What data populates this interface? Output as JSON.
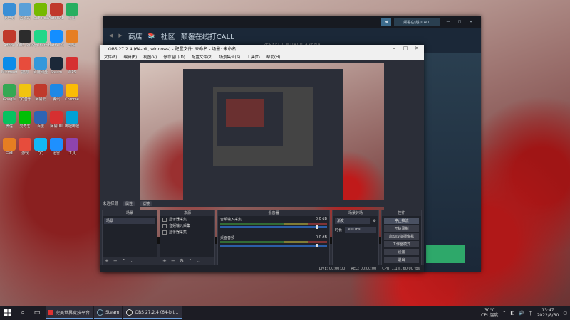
{
  "desktop": {
    "icons": [
      {
        "label": "此电脑",
        "color": "#3a8fd6"
      },
      {
        "label": "回收站",
        "color": "#5aa0d8"
      },
      {
        "label": "GeForce",
        "color": "#76b900"
      },
      {
        "label": "AutoCAD 2014",
        "color": "#c0392b"
      },
      {
        "label": "绘图",
        "color": "#27ae60"
      },
      {
        "label": "Adobe",
        "color": "#c0392b"
      },
      {
        "label": "OBS Studio",
        "color": "#2c2c2c"
      },
      {
        "label": "PyCharm",
        "color": "#21d789"
      },
      {
        "label": "Battle.net",
        "color": "#148eff"
      },
      {
        "label": "剪辑",
        "color": "#e67e22"
      },
      {
        "label": "Microsoft Edge",
        "color": "#0c8ce9"
      },
      {
        "label": "搜狗",
        "color": "#e74c3c"
      },
      {
        "label": "百度网盘",
        "color": "#3498db"
      },
      {
        "label": "Steam",
        "color": "#1b2838"
      },
      {
        "label": "WPS",
        "color": "#d63031"
      },
      {
        "label": "Google",
        "color": "#34a853"
      },
      {
        "label": "QQ音乐",
        "color": "#f1c40f"
      },
      {
        "label": "网易云",
        "color": "#c0392b"
      },
      {
        "label": "腾讯",
        "color": "#1e88e5"
      },
      {
        "label": "Chrome",
        "color": "#fbbc05"
      },
      {
        "label": "微信",
        "color": "#07c160"
      },
      {
        "label": "爱奇艺",
        "color": "#00be06"
      },
      {
        "label": "百度",
        "color": "#2d64b3"
      },
      {
        "label": "网易UU",
        "color": "#d63031"
      },
      {
        "label": "哔哩哔哩",
        "color": "#00a1d6"
      },
      {
        "label": "三维",
        "color": "#e67e22"
      },
      {
        "label": "游戏",
        "color": "#e74c3c"
      },
      {
        "label": "QQ",
        "color": "#12b7f5"
      },
      {
        "label": "迅雷",
        "color": "#1e90ff"
      },
      {
        "label": "工具",
        "color": "#8e44ad"
      }
    ]
  },
  "steam": {
    "nav": {
      "back": "◀",
      "forward": "▶",
      "store": "商店",
      "community": "社区",
      "user": "颠覆在线打CALL"
    },
    "brand": "PERFECT WORLD ARENA",
    "top_right": {
      "friend_label": "颠覆在线打CALL"
    }
  },
  "obs": {
    "title": "OBS 27.2.4 (64-bit, windows) - 配置文件: 未命名 - 场景: 未命名",
    "menu": [
      "文件(F)",
      "编辑(E)",
      "视图(V)",
      "停靠窗口(D)",
      "配置文件(P)",
      "场景集合(S)",
      "工具(T)",
      "帮助(H)"
    ],
    "dock_bar": {
      "label": "未选择源",
      "properties": "属性",
      "filters": "滤镜"
    },
    "docks": {
      "scenes": {
        "title": "场景",
        "items": [
          "场景"
        ]
      },
      "sources": {
        "title": "来源",
        "items": [
          "显示器采集",
          "音频输入采集",
          "显示器采集"
        ]
      },
      "mixer": {
        "title": "混音器",
        "channels": [
          {
            "name": "音频输入采集",
            "db": "0.0 dB"
          },
          {
            "name": "桌面音频",
            "db": "0.0 dB"
          }
        ]
      },
      "transitions": {
        "title": "场景转场",
        "type": "渐变",
        "duration_label": "时长",
        "duration": "300 ms"
      },
      "controls": {
        "title": "控件",
        "buttons": [
          "停止推流",
          "开始录制",
          "启动虚拟摄像机",
          "工作室模式",
          "设置",
          "退出"
        ]
      }
    },
    "status": {
      "live": "LIVE: 00:00:00",
      "rec": "REC: 00:00:00",
      "cpu": "CPU: 1.1%, 60.00 fps"
    }
  },
  "taskbar": {
    "tasks": [
      {
        "label": "完美世界竞技平台"
      },
      {
        "label": "Steam"
      },
      {
        "label": "OBS 27.2.4 (64-bit..."
      }
    ],
    "weather": "30°C",
    "weather_desc": "CPU温度",
    "time": "13:47",
    "date": "2022/8/30"
  }
}
